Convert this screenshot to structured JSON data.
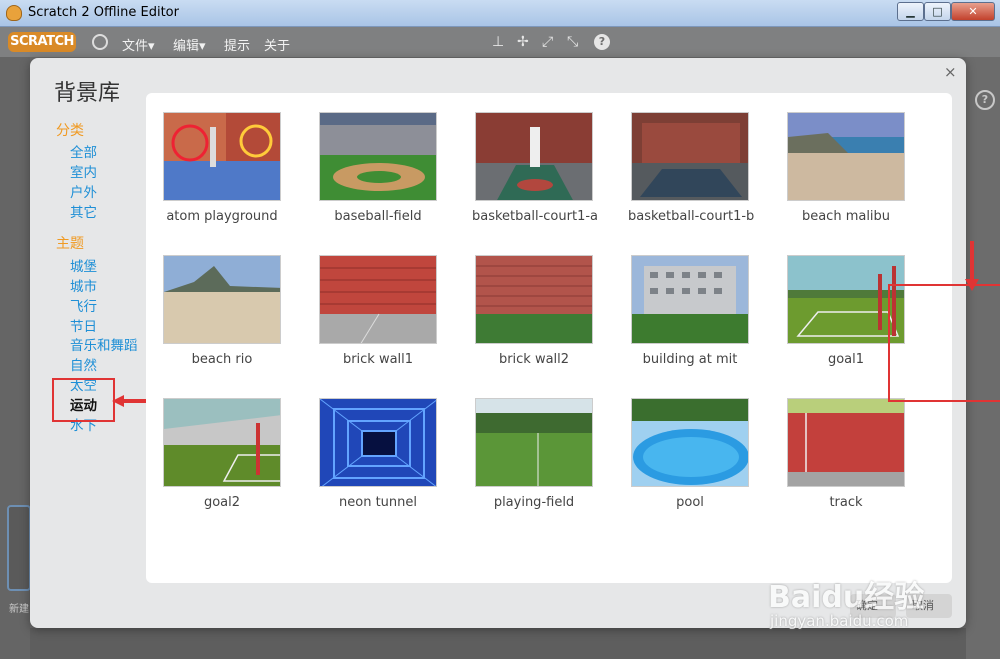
{
  "window": {
    "title": "Scratch 2 Offline Editor",
    "minimize": "▁",
    "maximize": "□",
    "close": "✕"
  },
  "menubar": {
    "logo": "SCRATCH",
    "items": [
      "文件▾",
      "编辑▾",
      "提示",
      "关于"
    ]
  },
  "modal": {
    "title": "背景库",
    "close": "×",
    "category_heading": "分类",
    "categories": [
      "全部",
      "室内",
      "户外",
      "其它"
    ],
    "theme_heading": "主题",
    "themes": [
      "城堡",
      "城市",
      "飞行",
      "节日",
      "音乐和舞蹈",
      "自然",
      "太空",
      "运动",
      "水下"
    ],
    "selected_theme": "运动",
    "backdrops": [
      "atom playground",
      "baseball-field",
      "basketball-court1-a",
      "basketball-court1-b",
      "beach malibu",
      "beach rio",
      "brick wall1",
      "brick wall2",
      "building at mit",
      "goal1",
      "goal2",
      "neon tunnel",
      "playing-field",
      "pool",
      "track"
    ],
    "highlighted_backdrop": "goal1",
    "ok_button": "确定",
    "cancel_button": "取消"
  },
  "workspace": {
    "new_label": "新建",
    "side_help": "?"
  },
  "watermark": {
    "brand": "Baidu经验",
    "url": "jingyan.baidu.com"
  },
  "colors": {
    "accent_red": "#e03434",
    "category_orange": "#f09a22",
    "link_blue": "#1e8fd6"
  }
}
